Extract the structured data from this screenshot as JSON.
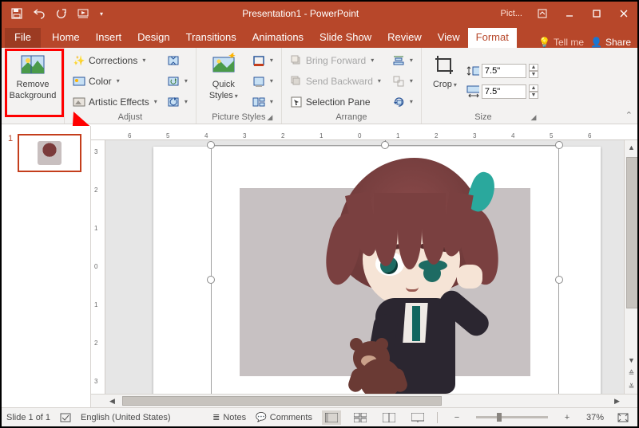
{
  "title": "Presentation1 - PowerPoint",
  "context_tools_label": "Pict...",
  "tabs": {
    "file": "File",
    "items": [
      "Home",
      "Insert",
      "Design",
      "Transitions",
      "Animations",
      "Slide Show",
      "Review",
      "View"
    ],
    "context": "Format",
    "tell_me": "Tell me",
    "share": "Share"
  },
  "ribbon": {
    "remove_bg": {
      "line1": "Remove",
      "line2": "Background"
    },
    "adjust": {
      "label": "Adjust",
      "corrections": "Corrections",
      "color": "Color",
      "artistic": "Artistic Effects"
    },
    "picture_styles": {
      "label": "Picture Styles",
      "quick_styles_line1": "Quick",
      "quick_styles_line2": "Styles"
    },
    "arrange": {
      "label": "Arrange",
      "bring_forward": "Bring Forward",
      "send_backward": "Send Backward",
      "selection_pane": "Selection Pane"
    },
    "size": {
      "label": "Size",
      "crop": "Crop",
      "height": "7.5\"",
      "width": "7.5\""
    }
  },
  "ruler_h_labels": [
    "6",
    "5",
    "4",
    "3",
    "2",
    "1",
    "0",
    "1",
    "2",
    "3",
    "4",
    "5",
    "6"
  ],
  "ruler_v_labels": [
    "3",
    "2",
    "1",
    "0",
    "1",
    "2",
    "3"
  ],
  "slides": {
    "thumb_number": "1"
  },
  "status": {
    "slide": "Slide 1 of 1",
    "lang": "English (United States)",
    "notes": "Notes",
    "comments": "Comments",
    "zoom": "37%"
  }
}
